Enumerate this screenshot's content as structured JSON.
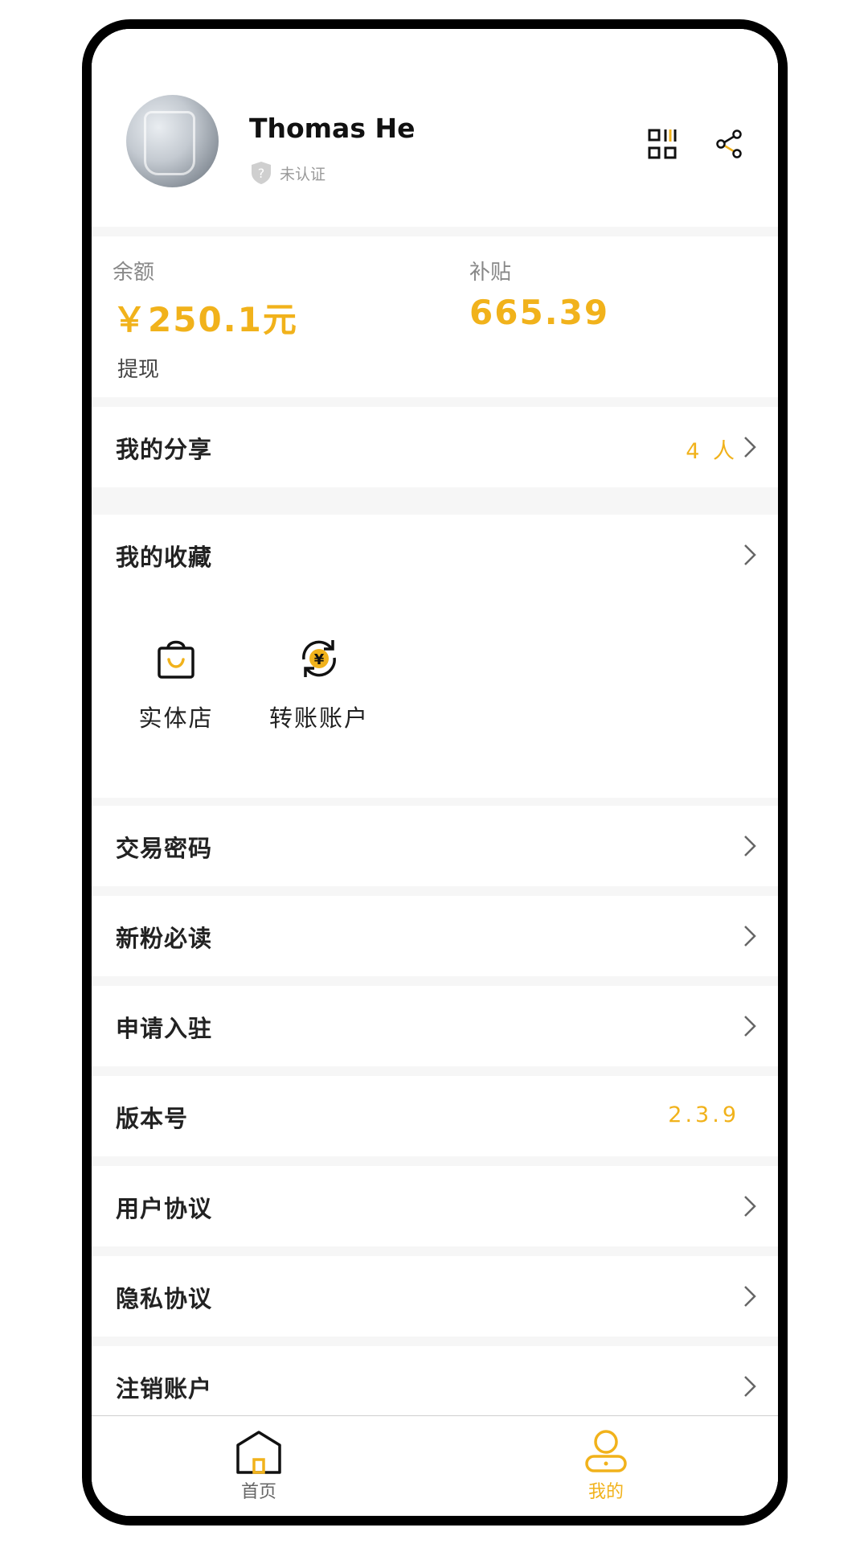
{
  "profile": {
    "name": "Thomas He",
    "verify_status": "未认证"
  },
  "balance": {
    "balance_label": "余额",
    "balance_value": "￥250.1元",
    "subsidy_label": "补贴",
    "subsidy_value": "665.39",
    "withdraw_label": "提现"
  },
  "menu": {
    "share_label": "我的分享",
    "share_value": "4 人",
    "favorites_label": "我的收藏",
    "trade_password_label": "交易密码",
    "newbie_label": "新粉必读",
    "apply_label": "申请入驻",
    "version_label": "版本号",
    "version_value": "2.3.9",
    "user_agreement_label": "用户协议",
    "privacy_label": "隐私协议",
    "cancel_account_label": "注销账户"
  },
  "favorites": [
    {
      "label": "实体店",
      "icon": "shopping-bag-icon"
    },
    {
      "label": "转账账户",
      "icon": "yuan-exchange-icon"
    }
  ],
  "tabbar": {
    "home_label": "首页",
    "mine_label": "我的",
    "active": "mine"
  },
  "colors": {
    "accent": "#f1b21b",
    "text": "#222222",
    "muted": "#888888",
    "background": "#f6f6f6"
  }
}
